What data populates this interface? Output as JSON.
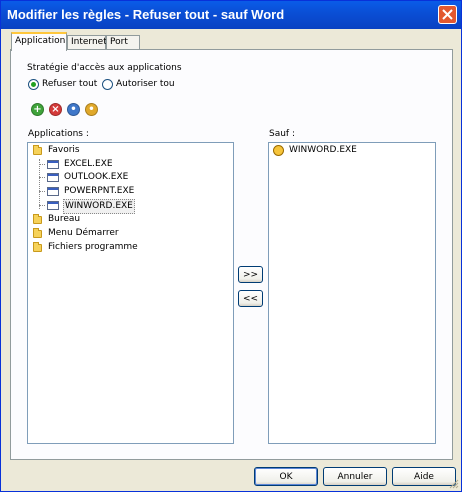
{
  "window": {
    "title": "Modifier les règles - Refuser tout - sauf Word"
  },
  "tabs": [
    {
      "label": "Application",
      "active": true
    },
    {
      "label": "Internet",
      "active": false
    },
    {
      "label": "Port",
      "active": false
    }
  ],
  "strategy": {
    "label": "Stratégie d'accès aux applications",
    "options": [
      {
        "label": "Refuser tout",
        "selected": true
      },
      {
        "label": "Autoriser tou",
        "selected": false
      }
    ]
  },
  "toolbar_icons": [
    "add-icon",
    "delete-icon",
    "edit-icon",
    "info-icon"
  ],
  "applications": {
    "label": "Applications :",
    "tree": [
      {
        "label": "Favoris",
        "type": "folder",
        "children": [
          {
            "label": "EXCEL.EXE"
          },
          {
            "label": "OUTLOOK.EXE"
          },
          {
            "label": "POWERPNT.EXE"
          },
          {
            "label": "WINWORD.EXE",
            "selected": true
          }
        ]
      },
      {
        "label": "Bureau",
        "type": "folder"
      },
      {
        "label": "Menu Démarrer",
        "type": "folder"
      },
      {
        "label": "Fichiers programme",
        "type": "folder"
      }
    ]
  },
  "move_buttons": {
    "add": ">>",
    "remove": "<<"
  },
  "sauf": {
    "label": "Sauf :",
    "items": [
      {
        "label": "WINWORD.EXE"
      }
    ]
  },
  "footer": {
    "ok": "OK",
    "cancel": "Annuler",
    "help": "Aide"
  },
  "colors": {
    "titlebar": "#0a52dc",
    "accent_radio": "#21a121",
    "close": "#e2582f"
  }
}
